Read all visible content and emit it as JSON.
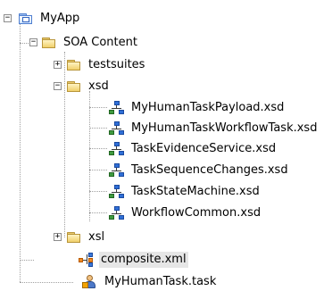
{
  "tree": {
    "root": {
      "label": "MyApp",
      "icon": "project-folder-icon",
      "expanded": true
    },
    "soa_content": {
      "label": "SOA Content",
      "icon": "folder-icon",
      "expanded": true
    },
    "testsuites": {
      "label": "testsuites",
      "icon": "folder-icon",
      "expanded": false
    },
    "xsd": {
      "label": "xsd",
      "icon": "folder-icon",
      "expanded": true,
      "files": [
        {
          "label": "MyHumanTaskPayload.xsd",
          "icon": "schema-file-icon"
        },
        {
          "label": "MyHumanTaskWorkflowTask.xsd",
          "icon": "schema-file-icon"
        },
        {
          "label": "TaskEvidenceService.xsd",
          "icon": "schema-file-icon"
        },
        {
          "label": "TaskSequenceChanges.xsd",
          "icon": "schema-file-icon"
        },
        {
          "label": "TaskStateMachine.xsd",
          "icon": "schema-file-icon"
        },
        {
          "label": "WorkflowCommon.xsd",
          "icon": "schema-file-icon"
        }
      ]
    },
    "xsl": {
      "label": "xsl",
      "icon": "folder-icon",
      "expanded": false
    },
    "composite": {
      "label": "composite.xml",
      "icon": "composite-file-icon",
      "selected": true
    },
    "task": {
      "label": "MyHumanTask.task",
      "icon": "human-task-file-icon"
    }
  },
  "toggle_symbols": {
    "expanded": "−",
    "collapsed": "+"
  },
  "colors": {
    "selection": "#e6e6e6",
    "tree_lines": "#a0a0a0",
    "folder": "#f0d06a",
    "project_folder": "#4f7fd0"
  }
}
